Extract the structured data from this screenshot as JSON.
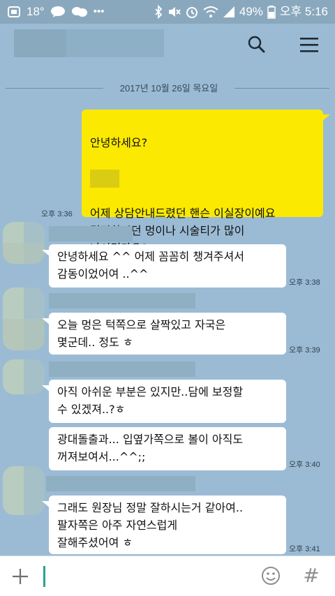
{
  "status_bar": {
    "temperature": "18°",
    "battery": "49%",
    "time": "오후 5:16"
  },
  "chat": {
    "date_divider": "2017년 10월 26일 목요일",
    "messages": [
      {
        "from": "me",
        "line1": "안녕하세요?",
        "body": "어제 상담안내드렸던 핸슨 이실장이예요\n걱정하시던 멍이나 시술티가 많이\n나시던가요?\n경과가 어떠세요?",
        "time": "오후 3:36"
      },
      {
        "from": "them",
        "text": "안녕하세요 ^^ 어제 꼼꼼히 챙겨주셔서\n감동이었어여 ..^^",
        "time": "오후 3:38"
      },
      {
        "from": "them",
        "text": "오늘 멍은 턱쪽으로 살짝있고 자국은\n몇군데.. 정도 ㅎ",
        "time": "오후 3:39"
      },
      {
        "from": "them",
        "text": "아직 아쉬운 부분은 있지만..담에 보정할\n수 있겠져..?ㅎ",
        "time": ""
      },
      {
        "from": "them",
        "text": "광대돌출과... 입옆가쪽으로 볼이 아직도\n꺼져보여서...^^;;",
        "time": "오후 3:40"
      },
      {
        "from": "them",
        "text": "그래도 원장님 정말 잘하시는거 같아여..\n팔자쪽은 아주 자연스럽게\n잘해주셨어여 ㅎ",
        "time": "오후 3:41"
      }
    ]
  },
  "input_bar": {
    "placeholder": "",
    "hash_label": "#"
  },
  "colors": {
    "chat_background": "#9bbbd4",
    "my_bubble": "#fbe901",
    "their_bubble": "#ffffff",
    "input_caret": "#2aa195"
  },
  "icons": [
    "search-icon",
    "menu-icon",
    "plus-icon",
    "emoji-icon",
    "hash-icon",
    "wifi-icon",
    "bluetooth-icon",
    "alarm-icon",
    "signal-icon",
    "battery-icon"
  ]
}
